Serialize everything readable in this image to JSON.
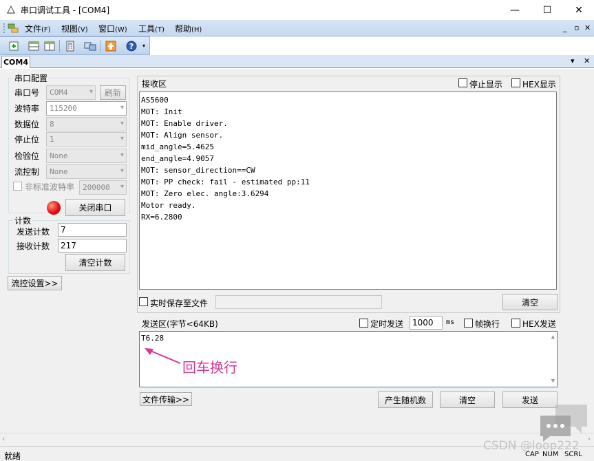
{
  "window": {
    "title": "串口调试工具 - [COM4]",
    "minimize": "—",
    "maximize": "☐",
    "close": "✕"
  },
  "menu": {
    "items": [
      {
        "label": "文件",
        "key": "(F)"
      },
      {
        "label": "视图",
        "key": "(V)"
      },
      {
        "label": "窗口",
        "key": "(W)"
      },
      {
        "label": "工具",
        "key": "(T)"
      },
      {
        "label": "帮助",
        "key": "(H)"
      }
    ],
    "mdi_minimize": "_",
    "mdi_restore": "▫",
    "mdi_close": "✕"
  },
  "toolbar": {
    "icons": [
      "new-connection-icon",
      "split-horizontal-icon",
      "split-vertical-icon",
      "calculator-icon",
      "screens-icon",
      "upload-icon",
      "help-icon"
    ]
  },
  "tabs": {
    "active": "COM4",
    "dropdown": "▾",
    "close": "✕"
  },
  "serial_config": {
    "title": "串口配置",
    "port_label": "串口号",
    "port_value": "COM4",
    "refresh_button": "刷新",
    "baud_label": "波特率",
    "baud_value": "115200",
    "databits_label": "数据位",
    "databits_value": "8",
    "stopbits_label": "停止位",
    "stopbits_value": "1",
    "parity_label": "检验位",
    "parity_value": "None",
    "flow_label": "流控制",
    "flow_value": "None",
    "custom_baud_label": "非标准波特率",
    "custom_baud_value": "200000",
    "close_port_button": "关闭串口"
  },
  "counter": {
    "title": "计数",
    "sent_label": "发送计数",
    "sent_value": "7",
    "recv_label": "接收计数",
    "recv_value": "217",
    "clear_button": "清空计数"
  },
  "flow_settings_button": "流控设置>>",
  "receive": {
    "title": "接收区",
    "stop_display_label": "停止显示",
    "hex_display_label": "HEX显示",
    "lines": [
      "AS5600",
      "MOT: Init",
      "MOT: Enable driver.",
      "MOT: Align sensor.",
      "mid_angle=5.4625",
      "end_angle=4.9057",
      "MOT: sensor_direction==CW",
      "MOT: PP check: fail - estimated pp:11",
      "MOT: Zero elec. angle:3.6294",
      "Motor ready.",
      "RX=6.2800"
    ],
    "save_to_file_label": "实时保存至文件",
    "save_path": "",
    "clear_button": "清空"
  },
  "send": {
    "title": "发送区(字节<64KB)",
    "timed_send_label": "定时发送",
    "interval_value": "1000",
    "interval_unit": "ms",
    "newline_label": "帧换行",
    "hex_send_label": "HEX发送",
    "content": "T6.28",
    "annotation": "回车换行",
    "file_transfer_button": "文件传输>>",
    "random_button": "产生随机数",
    "clear_button": "清空",
    "send_button": "发送"
  },
  "status": {
    "text": "就绪",
    "caps": "CAP",
    "num": "NUM",
    "scrl": "SCRL"
  },
  "watermark": "CSDN @loop222"
}
